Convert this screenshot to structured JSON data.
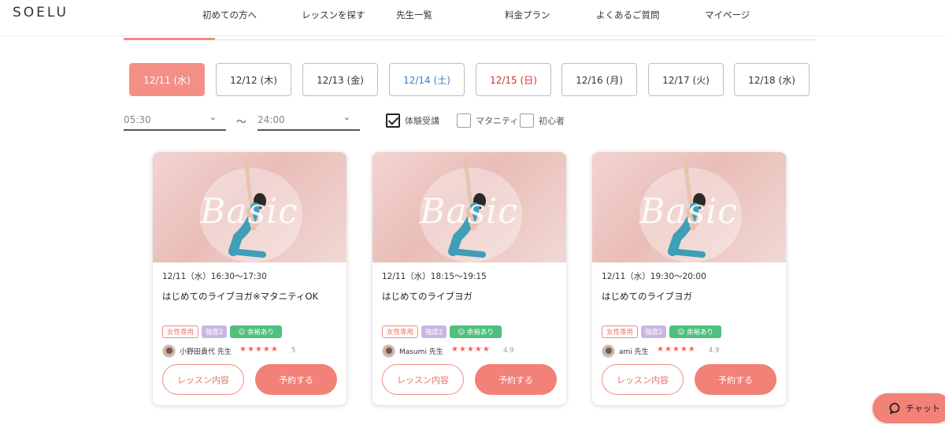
{
  "logo": "SOELU",
  "nav": [
    "初めての方へ",
    "レッスンを探す",
    "先生一覧",
    "料金プラン",
    "よくあるご質問",
    "マイページ"
  ],
  "dates": [
    {
      "label": "12/11 (水)",
      "kind": "active"
    },
    {
      "label": "12/12 (木)",
      "kind": "weekday"
    },
    {
      "label": "12/13 (金)",
      "kind": "weekday"
    },
    {
      "label": "12/14 (土)",
      "kind": "sat"
    },
    {
      "label": "12/15 (日)",
      "kind": "sun"
    },
    {
      "label": "12/16 (月)",
      "kind": "weekday"
    },
    {
      "label": "12/17 (火)",
      "kind": "weekday"
    },
    {
      "label": "12/18 (水)",
      "kind": "weekday"
    }
  ],
  "time_filter": {
    "from": "05:30",
    "separator": "〜",
    "to": "24:00"
  },
  "checkboxes": [
    {
      "label": "体験受講",
      "checked": true
    },
    {
      "label": "マタニティ",
      "checked": false
    },
    {
      "label": "初心者",
      "checked": false
    }
  ],
  "cards": [
    {
      "image_text": "Basic",
      "time": "12/11（水）16:30〜17:30",
      "title": "はじめてのライブヨガ※マタニティOK",
      "tags": {
        "women": "女性専用",
        "level": "強度2",
        "avail": "☺ 余裕あり"
      },
      "teacher": "小野田貴代 先生",
      "stars": "★★★★★",
      "rating": "5",
      "btn_detail": "レッスン内容",
      "btn_reserve": "予約する"
    },
    {
      "image_text": "Basic",
      "time": "12/11（水）18:15〜19:15",
      "title": "はじめてのライブヨガ",
      "tags": {
        "women": "女性専用",
        "level": "強度2",
        "avail": "☺ 余裕あり"
      },
      "teacher": "Masumi 先生",
      "stars": "★★★★★",
      "rating": "4.9",
      "btn_detail": "レッスン内容",
      "btn_reserve": "予約する"
    },
    {
      "image_text": "Basic",
      "time": "12/11（水）19:30〜20:00",
      "title": "はじめてのライブヨガ",
      "tags": {
        "women": "女性専用",
        "level": "強度2",
        "avail": "☺ 余裕あり"
      },
      "teacher": "ami 先生",
      "stars": "★★★★★",
      "rating": "4.9",
      "btn_detail": "レッスン内容",
      "btn_reserve": "予約する"
    }
  ],
  "chat": {
    "label": "チャット",
    "icon": "chat-bubble-icon"
  },
  "colors": {
    "accent": "#f28178",
    "saturday": "#3a7bd5",
    "sunday": "#d32f2f",
    "available": "#4fc17d",
    "level": "#c9b6e4"
  }
}
